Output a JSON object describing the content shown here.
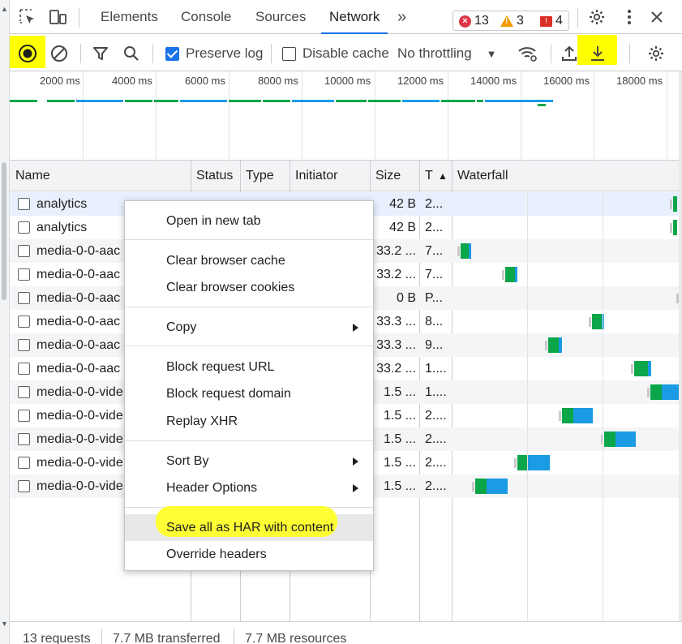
{
  "tabs": [
    {
      "label": "Elements",
      "active": false
    },
    {
      "label": "Console",
      "active": false
    },
    {
      "label": "Sources",
      "active": false
    },
    {
      "label": "Network",
      "active": true
    }
  ],
  "more_tabs_glyph": "»",
  "badges": {
    "errors": "13",
    "warnings": "3",
    "issues": "4"
  },
  "toolbar": {
    "preserve_log_label": "Preserve log",
    "preserve_log_checked": true,
    "disable_cache_label": "Disable cache",
    "disable_cache_checked": false,
    "throttling_value": "No throttling"
  },
  "overview": {
    "ticks": [
      "2000 ms",
      "4000 ms",
      "6000 ms",
      "8000 ms",
      "10000 ms",
      "12000 ms",
      "14000 ms",
      "16000 ms",
      "18000 ms"
    ]
  },
  "columns": {
    "name": "Name",
    "status": "Status",
    "type": "Type",
    "initiator": "Initiator",
    "size": "Size",
    "time": "T",
    "waterfall": "Waterfall"
  },
  "rows": [
    {
      "name": "analytics",
      "size": "42 B",
      "time": "2..."
    },
    {
      "name": "analytics",
      "size": "42 B",
      "time": "2..."
    },
    {
      "name": "media-0-0-aac",
      "size": "33.2 ...",
      "time": "7..."
    },
    {
      "name": "media-0-0-aac",
      "size": "33.2 ...",
      "time": "7..."
    },
    {
      "name": "media-0-0-aac",
      "size": "0 B",
      "time": "P..."
    },
    {
      "name": "media-0-0-aac",
      "size": "33.3 ...",
      "time": "8..."
    },
    {
      "name": "media-0-0-aac",
      "size": "33.3 ...",
      "time": "9..."
    },
    {
      "name": "media-0-0-aac",
      "size": "33.2 ...",
      "time": "1...."
    },
    {
      "name": "media-0-0-vide",
      "size": "1.5 ...",
      "time": "1...."
    },
    {
      "name": "media-0-0-vide",
      "size": "1.5 ...",
      "time": "2...."
    },
    {
      "name": "media-0-0-vide",
      "size": "1.5 ...",
      "time": "2...."
    },
    {
      "name": "media-0-0-vide",
      "size": "1.5 ...",
      "time": "2...."
    },
    {
      "name": "media-0-0-vide",
      "size": "1.5 ...",
      "time": "2...."
    }
  ],
  "context_menu": {
    "open_new_tab": "Open in new tab",
    "clear_cache": "Clear browser cache",
    "clear_cookies": "Clear browser cookies",
    "copy": "Copy",
    "block_url": "Block request URL",
    "block_domain": "Block request domain",
    "replay_xhr": "Replay XHR",
    "sort_by": "Sort By",
    "header_options": "Header Options",
    "save_har": "Save all as HAR with content",
    "override_headers": "Override headers"
  },
  "status_bar": {
    "requests": "13 requests",
    "transferred": "7.7 MB transferred",
    "resources": "7.7 MB resources"
  },
  "colors": {
    "accent": "#1a73e8",
    "highlight": "#ffff00",
    "timing_green": "#0aa649",
    "timing_blue": "#1a9be3",
    "error_red": "#dc3545",
    "warning_orange": "#f29900"
  }
}
